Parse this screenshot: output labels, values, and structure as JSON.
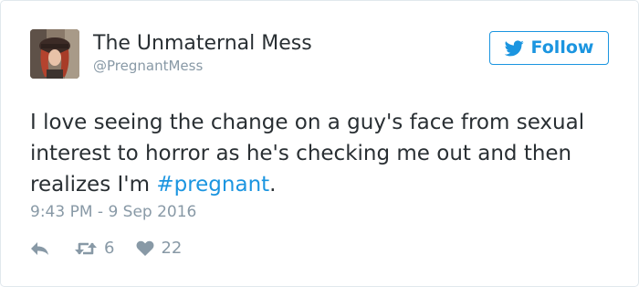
{
  "tweet": {
    "author": {
      "display_name": "The Unmaternal Mess",
      "handle": "@PregnantMess",
      "avatar_icon": "profile-photo"
    },
    "follow_button": {
      "label": "Follow",
      "icon": "twitter-bird-icon",
      "color": "#1b95e0"
    },
    "text": {
      "before_hashtag": "I love seeing the change on a guy's face from sexual interest to horror as he's checking me out and then realizes I'm ",
      "hashtag": "#pregnant",
      "after_hashtag": "."
    },
    "timestamp": "9:43 PM - 9 Sep 2016",
    "actions": {
      "reply_icon": "reply-icon",
      "retweet_icon": "retweet-icon",
      "retweet_count": "6",
      "like_icon": "heart-icon",
      "like_count": "22"
    }
  }
}
